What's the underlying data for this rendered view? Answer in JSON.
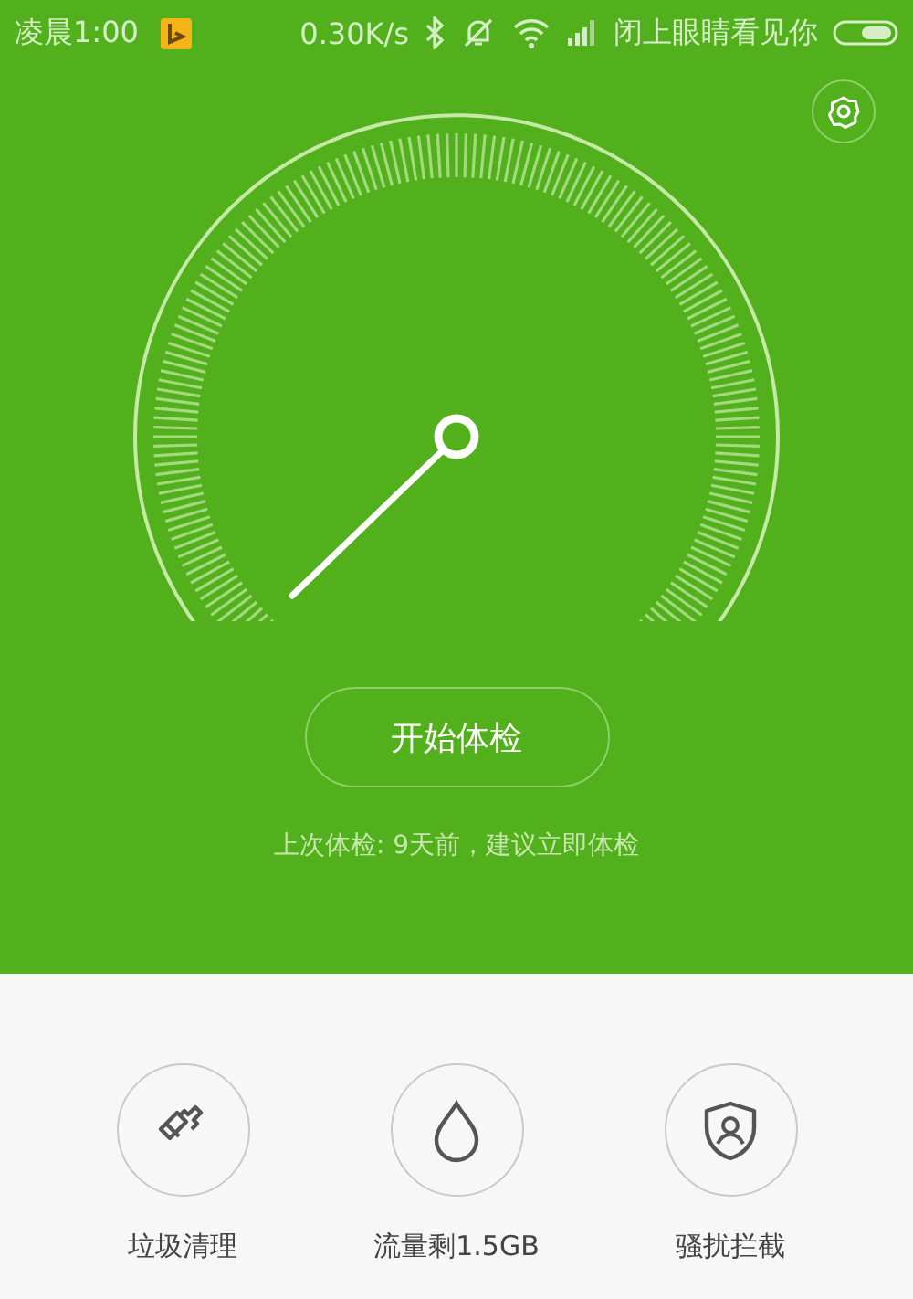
{
  "status_bar": {
    "time": "凌晨1:00",
    "speed": "0.30K/s",
    "carrier": "闭上眼睛看见你"
  },
  "checkup": {
    "button": "开始体检",
    "last_check": "上次体检: 9天前，建议立即体检"
  },
  "tools": [
    {
      "kind": "broom",
      "label": "垃圾清理"
    },
    {
      "kind": "drop",
      "label": "流量剩1.5GB"
    },
    {
      "kind": "shield",
      "label": "骚扰拦截"
    }
  ]
}
